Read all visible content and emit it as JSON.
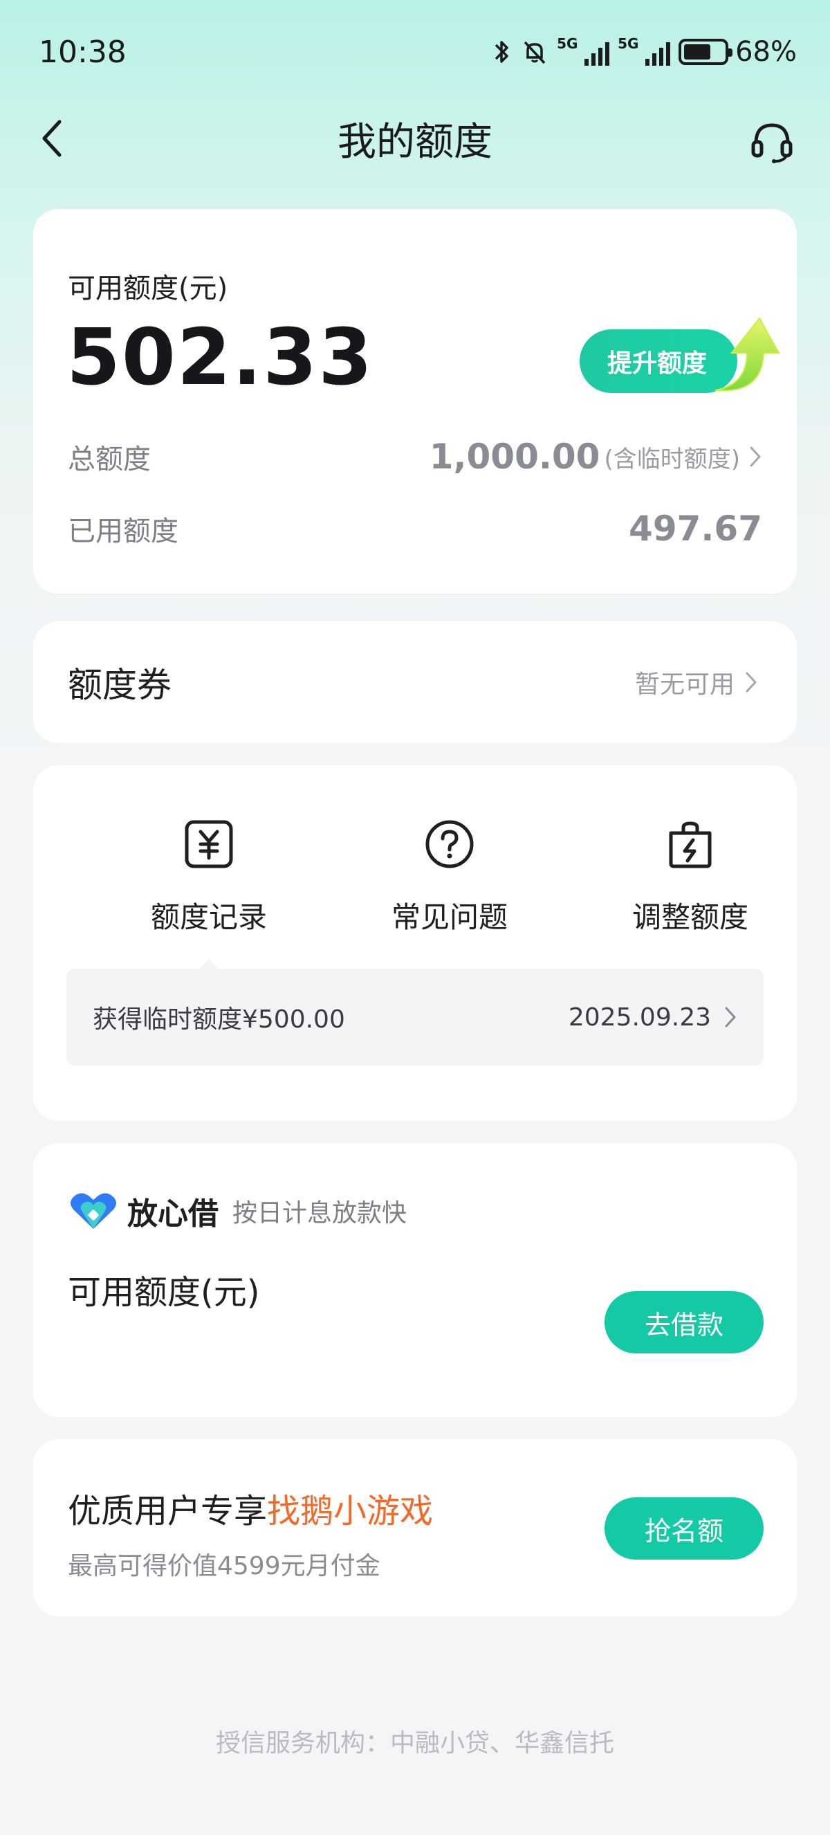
{
  "status_bar": {
    "time": "10:38",
    "battery_level": "68%",
    "network_1": "5G",
    "network_2": "5G"
  },
  "nav": {
    "title": "我的额度",
    "back_icon": "chevron-left-icon",
    "service_icon": "headset-icon"
  },
  "quota": {
    "available_label": "可用额度(元)",
    "available_amount": "502.33",
    "raise_button": "提升额度",
    "total_label": "总额度",
    "total_amount": "1,000.00",
    "total_note": "(含临时额度)",
    "used_label": "已用额度",
    "used_amount": "497.67"
  },
  "coupon": {
    "title": "额度券",
    "status": "暂无可用"
  },
  "menu": {
    "items": [
      {
        "label": "额度记录",
        "icon": "yuan-receipt-icon"
      },
      {
        "label": "常见问题",
        "icon": "question-circle-icon"
      },
      {
        "label": "调整额度",
        "icon": "bag-lightning-icon"
      }
    ],
    "record": {
      "text": "获得临时额度¥500.00",
      "date": "2025.09.23"
    }
  },
  "loan": {
    "brand": "放心借",
    "slogan": "按日计息放款快",
    "available_label": "可用额度(元)",
    "button": "去借款"
  },
  "promo": {
    "title_prefix": "优质用户专享",
    "title_highlight": "找鹅小游戏",
    "subtitle": "最高可得价值4599元月付金",
    "button": "抢名额"
  },
  "footer": {
    "text": "授信服务机构：中融小贷、华鑫信托"
  },
  "colors": {
    "accent": "#14c9a6",
    "highlight": "#f26a2a",
    "header_mint": "#b9f1e6"
  }
}
